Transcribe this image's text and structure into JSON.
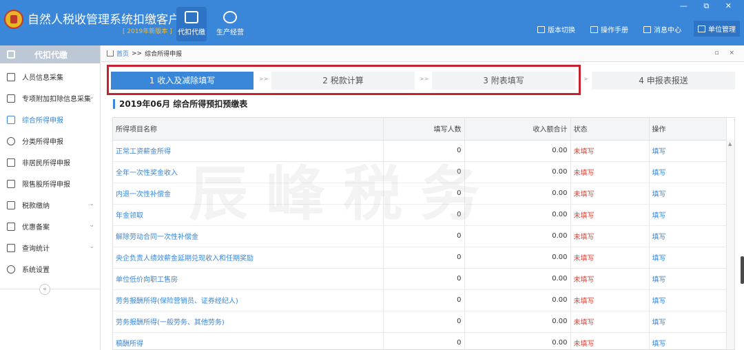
{
  "header": {
    "title": "自然人税收管理系统扣缴客户端",
    "version": "[ 2019年新版本 ]",
    "modules": [
      {
        "label": "代扣代缴",
        "icon": "wallet-icon"
      },
      {
        "label": "生产经营",
        "icon": "coins-icon"
      }
    ],
    "actions": [
      {
        "label": "版本切换",
        "icon": "switch-icon"
      },
      {
        "label": "操作手册",
        "icon": "manual-icon"
      },
      {
        "label": "消息中心",
        "icon": "mail-icon"
      },
      {
        "label": "单位管理",
        "icon": "building-icon"
      }
    ],
    "window_controls": "— ⧉ ✕"
  },
  "sidebar": {
    "title": "代扣代缴",
    "items": [
      {
        "label": "人员信息采集",
        "icon": "person-icon"
      },
      {
        "label": "专项附加扣除信息采集",
        "icon": "list-icon",
        "chevron": "⌄"
      },
      {
        "label": "综合所得申报",
        "icon": "layers-icon",
        "active": true
      },
      {
        "label": "分类所得申报",
        "icon": "pie-icon"
      },
      {
        "label": "非居民所得申报",
        "icon": "user-icon"
      },
      {
        "label": "限售股所得申报",
        "icon": "bar-chart-icon"
      },
      {
        "label": "税款缴纳",
        "icon": "folder-icon",
        "chevron": "⌄"
      },
      {
        "label": "优惠备案",
        "icon": "document-icon",
        "chevron": "⌄"
      },
      {
        "label": "查询统计",
        "icon": "query-icon",
        "chevron": "⌄"
      },
      {
        "label": "系统设置",
        "icon": "gear-icon"
      }
    ],
    "collapse": "«"
  },
  "breadcrumb": {
    "home": "首页",
    "sep": ">>",
    "current": "综合所得申报",
    "controls": "▫ ×"
  },
  "steps": [
    {
      "label": "1 收入及减除填写",
      "active": true
    },
    {
      "label": "2 税款计算"
    },
    {
      "label": "3 附表填写"
    },
    {
      "label": "4 申报表报送"
    }
  ],
  "step_separator": ">>",
  "step_separator_last": ">",
  "section": {
    "title": "2019年06月  综合所得预扣预缴表"
  },
  "table": {
    "headers": [
      "所得项目名称",
      "填写人数",
      "收入额合计",
      "状态",
      "操作"
    ],
    "rows": [
      {
        "name": "正常工资薪金所得",
        "count": "0",
        "income": "0.00",
        "status": "未填写",
        "op": "填写"
      },
      {
        "name": "全年一次性奖金收入",
        "count": "0",
        "income": "0.00",
        "status": "未填写",
        "op": "填写"
      },
      {
        "name": "内退一次性补偿金",
        "count": "0",
        "income": "0.00",
        "status": "未填写",
        "op": "填写"
      },
      {
        "name": "年金领取",
        "count": "0",
        "income": "0.00",
        "status": "未填写",
        "op": "填写"
      },
      {
        "name": "解除劳动合同一次性补偿金",
        "count": "0",
        "income": "0.00",
        "status": "未填写",
        "op": "填写"
      },
      {
        "name": "央企负责人绩效薪金延期兑现收入和任期奖励",
        "count": "0",
        "income": "0.00",
        "status": "未填写",
        "op": "填写"
      },
      {
        "name": "单位低价向职工售房",
        "count": "0",
        "income": "0.00",
        "status": "未填写",
        "op": "填写"
      },
      {
        "name": "劳务报酬所得(保险营销员、证券经纪人)",
        "count": "0",
        "income": "0.00",
        "status": "未填写",
        "op": "填写"
      },
      {
        "name": "劳务报酬所得(一般劳务、其他劳务)",
        "count": "0",
        "income": "0.00",
        "status": "未填写",
        "op": "填写"
      },
      {
        "name": "稿酬所得",
        "count": "0",
        "income": "0.00",
        "status": "未填写",
        "op": "填写"
      }
    ]
  },
  "watermark": "辰峰税务"
}
